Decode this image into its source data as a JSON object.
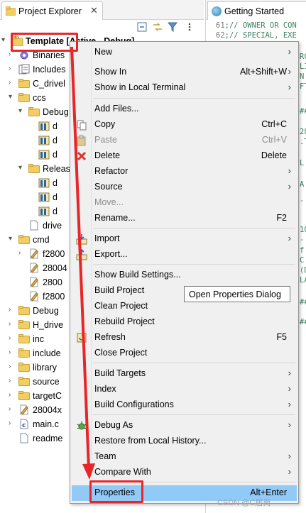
{
  "explorer": {
    "tab_title": "Project Explorer",
    "tab_close": "✕",
    "tree": [
      {
        "label": "Template  [Active - Debug]",
        "icon": "ccs-project-icon",
        "twisty": "▾"
      },
      {
        "label": "Binaries",
        "icon": "binaries-icon",
        "twisty": "›"
      },
      {
        "label": "Includes",
        "icon": "includes-icon",
        "twisty": "›"
      },
      {
        "label": "C_drivel",
        "icon": "folder-icon",
        "twisty": "›"
      },
      {
        "label": "ccs",
        "icon": "folder-icon",
        "twisty": "▾"
      },
      {
        "label": "Debug",
        "icon": "folder-icon",
        "twisty": "▾"
      },
      {
        "label": "d",
        "icon": "library-icon",
        "twisty": ""
      },
      {
        "label": "d",
        "icon": "library-icon",
        "twisty": ""
      },
      {
        "label": "d",
        "icon": "library-icon",
        "twisty": ""
      },
      {
        "label": "Release",
        "icon": "folder-icon",
        "twisty": "▾"
      },
      {
        "label": "d",
        "icon": "library-icon",
        "twisty": ""
      },
      {
        "label": "d",
        "icon": "library-icon",
        "twisty": ""
      },
      {
        "label": "d",
        "icon": "library-icon",
        "twisty": ""
      },
      {
        "label": "drive",
        "icon": "file-icon",
        "twisty": ""
      },
      {
        "label": "cmd",
        "icon": "folder-icon",
        "twisty": "▾"
      },
      {
        "label": "f2800",
        "icon": "pen-file-icon",
        "twisty": "›"
      },
      {
        "label": "28004",
        "icon": "pen-file-icon",
        "twisty": ""
      },
      {
        "label": "2800",
        "icon": "pen-file-icon",
        "twisty": ""
      },
      {
        "label": "f2800",
        "icon": "pen-file-icon",
        "twisty": ""
      },
      {
        "label": "Debug",
        "icon": "folder-icon",
        "twisty": "›"
      },
      {
        "label": "H_drive",
        "icon": "folder-icon",
        "twisty": "›"
      },
      {
        "label": "inc",
        "icon": "folder-icon",
        "twisty": "›"
      },
      {
        "label": "include",
        "icon": "folder-icon",
        "twisty": "›"
      },
      {
        "label": "library",
        "icon": "folder-icon",
        "twisty": "›"
      },
      {
        "label": "source",
        "icon": "folder-icon",
        "twisty": "›"
      },
      {
        "label": "targetC",
        "icon": "folder-icon",
        "twisty": "›"
      },
      {
        "label": "28004x",
        "icon": "pen-file-icon",
        "twisty": "›"
      },
      {
        "label": "main.c",
        "icon": "c-file-icon",
        "twisty": "›"
      },
      {
        "label": "readme",
        "icon": "file-icon",
        "twisty": ""
      }
    ]
  },
  "editor": {
    "tab_title": "Getting Started",
    "code_lines": [
      {
        "num": "61",
        "text": ";// OWNER OR CON"
      },
      {
        "num": "62",
        "text": ";// SPECIAL, EXE"
      }
    ],
    "fragments": [
      "RC",
      "LI",
      "N",
      "FT",
      "##",
      "28",
      ".T",
      "L",
      "A",
      "-",
      "10",
      "-",
      "f",
      "C",
      "(D",
      "LA",
      "##",
      "##"
    ]
  },
  "menu": {
    "items": [
      {
        "label": "New",
        "shortcut": "",
        "submenu": true,
        "disabled": false,
        "icon": ""
      },
      {
        "label": "Show In",
        "shortcut": "Alt+Shift+W",
        "submenu": true,
        "disabled": false,
        "icon": ""
      },
      {
        "label": "Show in Local Terminal",
        "shortcut": "",
        "submenu": true,
        "disabled": false,
        "icon": ""
      },
      {
        "label": "Add Files...",
        "shortcut": "",
        "submenu": false,
        "disabled": false,
        "icon": ""
      },
      {
        "label": "Copy",
        "shortcut": "Ctrl+C",
        "submenu": false,
        "disabled": false,
        "icon": "copy-icon"
      },
      {
        "label": "Paste",
        "shortcut": "Ctrl+V",
        "submenu": false,
        "disabled": true,
        "icon": "paste-icon"
      },
      {
        "label": "Delete",
        "shortcut": "Delete",
        "submenu": false,
        "disabled": false,
        "icon": "delete-icon"
      },
      {
        "label": "Refactor",
        "shortcut": "",
        "submenu": true,
        "disabled": false,
        "icon": ""
      },
      {
        "label": "Source",
        "shortcut": "",
        "submenu": true,
        "disabled": false,
        "icon": ""
      },
      {
        "label": "Move...",
        "shortcut": "",
        "submenu": false,
        "disabled": true,
        "icon": ""
      },
      {
        "label": "Rename...",
        "shortcut": "F2",
        "submenu": false,
        "disabled": false,
        "icon": ""
      },
      {
        "label": "Import",
        "shortcut": "",
        "submenu": true,
        "disabled": false,
        "icon": "import-icon"
      },
      {
        "label": "Export...",
        "shortcut": "",
        "submenu": false,
        "disabled": false,
        "icon": "export-icon"
      },
      {
        "label": "Show Build Settings...",
        "shortcut": "",
        "submenu": false,
        "disabled": false,
        "icon": ""
      },
      {
        "label": "Build Project",
        "shortcut": "",
        "submenu": false,
        "disabled": false,
        "icon": ""
      },
      {
        "label": "Clean Project",
        "shortcut": "",
        "submenu": false,
        "disabled": false,
        "icon": ""
      },
      {
        "label": "Rebuild Project",
        "shortcut": "",
        "submenu": false,
        "disabled": false,
        "icon": ""
      },
      {
        "label": "Refresh",
        "shortcut": "F5",
        "submenu": false,
        "disabled": false,
        "icon": "refresh-icon"
      },
      {
        "label": "Close Project",
        "shortcut": "",
        "submenu": false,
        "disabled": false,
        "icon": ""
      },
      {
        "label": "Build Targets",
        "shortcut": "",
        "submenu": true,
        "disabled": false,
        "icon": ""
      },
      {
        "label": "Index",
        "shortcut": "",
        "submenu": true,
        "disabled": false,
        "icon": ""
      },
      {
        "label": "Build Configurations",
        "shortcut": "",
        "submenu": true,
        "disabled": false,
        "icon": ""
      },
      {
        "label": "Debug As",
        "shortcut": "",
        "submenu": true,
        "disabled": false,
        "icon": "debug-icon"
      },
      {
        "label": "Restore from Local History...",
        "shortcut": "",
        "submenu": false,
        "disabled": false,
        "icon": ""
      },
      {
        "label": "Team",
        "shortcut": "",
        "submenu": true,
        "disabled": false,
        "icon": ""
      },
      {
        "label": "Compare With",
        "shortcut": "",
        "submenu": true,
        "disabled": false,
        "icon": ""
      },
      {
        "label": "Properties",
        "shortcut": "Alt+Enter",
        "submenu": false,
        "disabled": false,
        "icon": "",
        "selected": true
      }
    ],
    "tooltip": "Open Properties Dialog"
  },
  "watermark": "CSDN @C居尚",
  "colors": {
    "annotation_red": "#e8262a",
    "selection_blue": "#91c9f7",
    "menu_bg": "#f0f0f0"
  }
}
